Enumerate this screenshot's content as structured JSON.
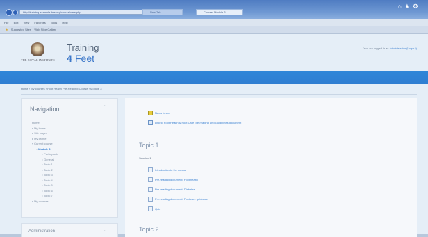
{
  "browser": {
    "address": "http://training.example-lms.org/course/view.php",
    "tabs": [
      {
        "label": "New Tab",
        "active": false
      },
      {
        "label": "Course: Module 3",
        "active": true
      }
    ],
    "menu": [
      "File",
      "Edit",
      "View",
      "Favorites",
      "Tools",
      "Help"
    ],
    "favorites": [
      "Suggested Sites",
      "Web Slice Gallery"
    ]
  },
  "site": {
    "institution": "THE ROYAL INSTITUTE",
    "logo_line1": "Training",
    "logo_4": "4",
    "logo_line2": "Feet",
    "login_text": "You are logged in as",
    "login_name": "Administrator (Logout)"
  },
  "breadcrumb": "Home  ›  My courses  ›  Foot Health Pre-Reading Course  ›  Module 3",
  "navigation": {
    "title": "Navigation",
    "control": "– ◻",
    "items": [
      {
        "label": "Home",
        "level": 0,
        "highlight": false
      },
      {
        "label": "My home",
        "level": 0,
        "highlight": false
      },
      {
        "label": "Site pages",
        "level": 0,
        "highlight": false
      },
      {
        "label": "My profile",
        "level": 0,
        "highlight": false
      },
      {
        "label": "Current course",
        "level": 0,
        "highlight": false
      },
      {
        "label": "Module 3",
        "level": 1,
        "highlight": true
      },
      {
        "label": "Participants",
        "level": 2,
        "highlight": false
      },
      {
        "label": "General",
        "level": 2,
        "highlight": false
      },
      {
        "label": "Topic 1",
        "level": 2,
        "highlight": false
      },
      {
        "label": "Topic 2",
        "level": 2,
        "highlight": false
      },
      {
        "label": "Topic 3",
        "level": 2,
        "highlight": false
      },
      {
        "label": "Topic 4",
        "level": 2,
        "highlight": false
      },
      {
        "label": "Topic 5",
        "level": 2,
        "highlight": false
      },
      {
        "label": "Topic 6",
        "level": 2,
        "highlight": false
      },
      {
        "label": "Topic 7",
        "level": 2,
        "highlight": false
      },
      {
        "label": "My courses",
        "level": 0,
        "highlight": false
      }
    ]
  },
  "admin_block": {
    "title": "Administration",
    "control": "– ◻"
  },
  "main": {
    "intro_links": [
      {
        "label": "News forum",
        "icon": "news"
      },
      {
        "label": "Link to Foot Health & Foot Care pre-reading and Guidelines document",
        "icon": "url"
      }
    ],
    "topic1": {
      "title": "Topic 1",
      "subtitle": "Session 1",
      "links": [
        "Introduction to the course",
        "Pre-reading document: Foot health",
        "Pre-reading document: Diabetes",
        "Pre-reading document: Foot care guidance",
        "Quiz"
      ]
    },
    "topic2": {
      "title": "Topic 2"
    }
  }
}
